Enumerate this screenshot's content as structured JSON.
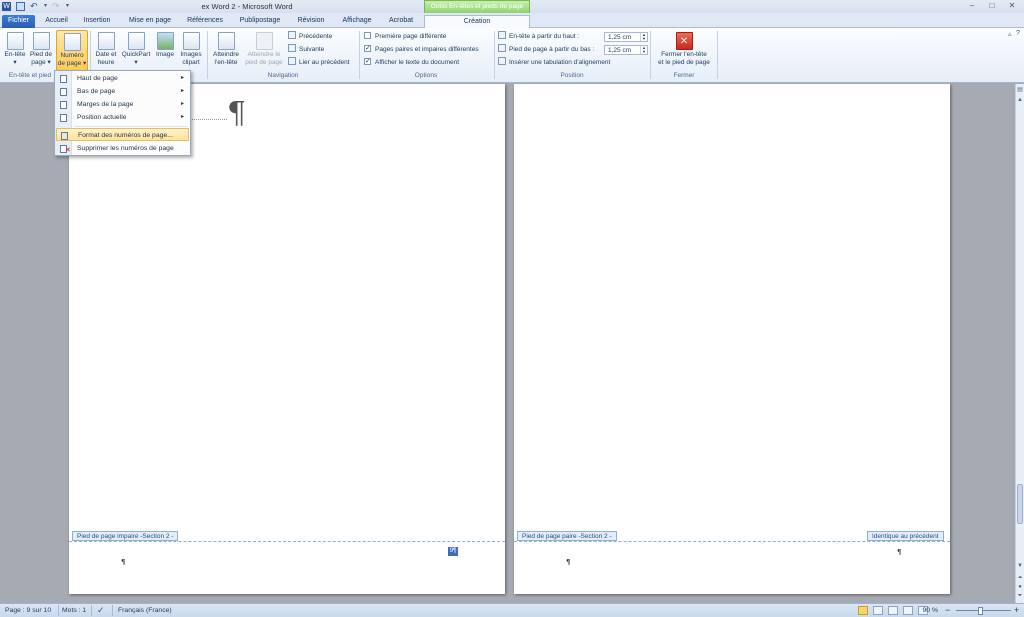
{
  "window": {
    "title": "ex Word 2 - Microsoft Word",
    "context_group": "Outils En-têtes et pieds de page"
  },
  "tabs": [
    {
      "label": "Fichier"
    },
    {
      "label": "Accueil"
    },
    {
      "label": "Insertion"
    },
    {
      "label": "Mise en page"
    },
    {
      "label": "Références"
    },
    {
      "label": "Publipostage"
    },
    {
      "label": "Révision"
    },
    {
      "label": "Affichage"
    },
    {
      "label": "Acrobat"
    },
    {
      "label": "Création"
    }
  ],
  "ribbon": {
    "hf_group": {
      "entete": [
        "En-tête",
        "▾"
      ],
      "pied": [
        "Pied de",
        "page ▾"
      ],
      "numero": [
        "Numéro",
        "de page ▾"
      ],
      "label": "En-tête et pied"
    },
    "insert_group": {
      "date": [
        "Date et",
        "heure"
      ],
      "quickpart": [
        "QuickPart",
        "▾"
      ],
      "image": [
        "Image"
      ],
      "clipart": [
        "Images",
        "clipart"
      ]
    },
    "navigation": {
      "atteindre_entete": [
        "Atteindre",
        "l'en-tête"
      ],
      "atteindre_pied": [
        "Atteindre le",
        "pied de page"
      ],
      "precedente": "Précédente",
      "suivante": "Suivante",
      "lier": "Lier au précédent",
      "label": "Navigation"
    },
    "options": {
      "premiere": {
        "label": "Première page différente",
        "checked": false
      },
      "paires": {
        "label": "Pages paires et impaires différentes",
        "checked": true
      },
      "afficher": {
        "label": "Afficher le texte du document",
        "checked": true
      },
      "label": "Options"
    },
    "position": {
      "entete_label": "En-tête à partir du haut :",
      "entete_value": "1,25 cm",
      "pied_label": "Pied de page à partir du bas :",
      "pied_value": "1,25 cm",
      "tabulation": "Insérer une tabulation d'alignement",
      "label": "Position"
    },
    "fermer": {
      "button": [
        "Fermer l'en-tête",
        "et le pied de page"
      ],
      "label": "Fermer"
    }
  },
  "menu": {
    "items": [
      {
        "label": "Haut de page",
        "submenu": "▸"
      },
      {
        "label": "Bas de page",
        "submenu": "▸"
      },
      {
        "label": "Marges de la page",
        "submenu": "▸"
      },
      {
        "label": "Position actuelle",
        "submenu": "▸"
      },
      {
        "label": "Format des numéros de page..."
      },
      {
        "label": "Supprimer les numéros de page"
      }
    ]
  },
  "document": {
    "pilcrow": "¶",
    "left_footer_tag": "Pied de page impaire -Section 2 -",
    "right_footer_tag": "Pied de page paire -Section 2 -",
    "right_same_as_prev": "Identique au précédent",
    "page_field": "9¶"
  },
  "statusbar": {
    "page": "Page : 9 sur 10",
    "words": "Mots : 1",
    "language": "Français (France)",
    "zoom": "90 %",
    "zoom_minus": "−",
    "zoom_plus": "+"
  },
  "colors": {
    "accent": "#2a5fb0",
    "context_green": "#8fd36a",
    "highlight": "#ffe39a"
  }
}
